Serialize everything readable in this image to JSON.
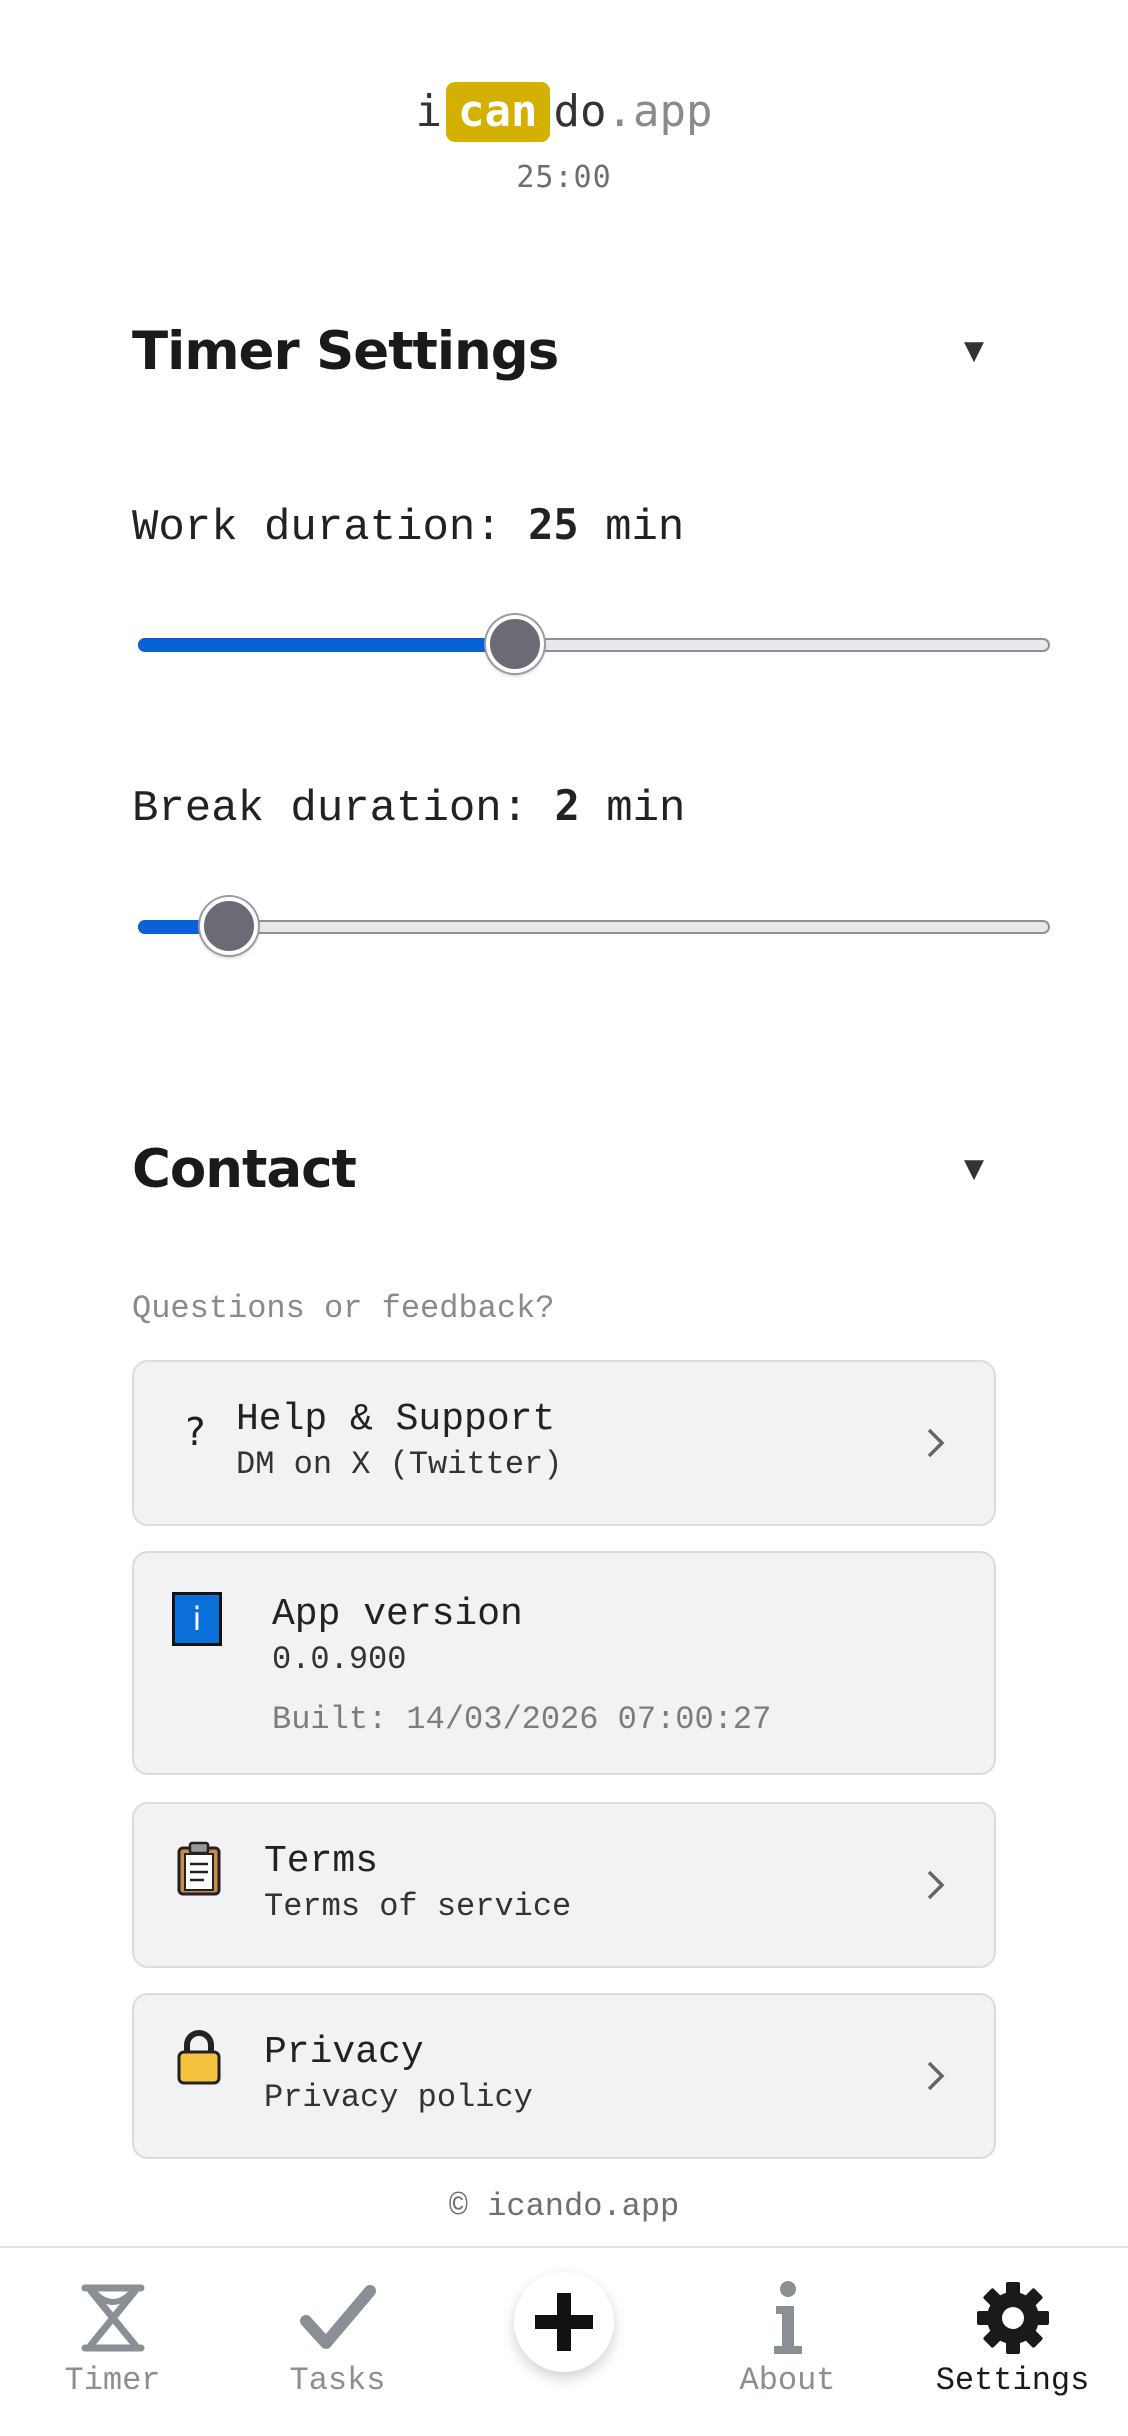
{
  "header": {
    "logo_prefix": "i",
    "logo_highlight": "can",
    "logo_mid": "do",
    "logo_suffix": ".app",
    "timer_display": "25:00"
  },
  "timer_settings": {
    "title": "Timer Settings",
    "caret": "▼",
    "work": {
      "label": "Work duration:",
      "value": "25",
      "unit": "min",
      "fill_fraction": 0.413
    },
    "break": {
      "label": "Break duration:",
      "value": "2",
      "unit": "min",
      "fill_fraction": 0.1
    }
  },
  "contact": {
    "title": "Contact",
    "caret": "▼",
    "subtitle": "Questions or feedback?",
    "help": {
      "icon": "?",
      "title": "Help & Support",
      "subtitle": "DM on X (Twitter)"
    },
    "version": {
      "icon": "i",
      "title": "App version",
      "number": "0.0.900",
      "built": "Built: 14/03/2026 07:00:27"
    },
    "terms": {
      "title": "Terms",
      "subtitle": "Terms of service"
    },
    "privacy": {
      "title": "Privacy",
      "subtitle": "Privacy policy"
    }
  },
  "footer": {
    "copyright": "© icando.app"
  },
  "nav": {
    "timer": "Timer",
    "tasks": "Tasks",
    "about": "About",
    "settings": "Settings",
    "active": "settings"
  },
  "colors": {
    "accent": "#0a61d6",
    "logo_highlight": "#d4b100",
    "card_bg": "#f2f2f4",
    "muted": "#8a8f96"
  }
}
